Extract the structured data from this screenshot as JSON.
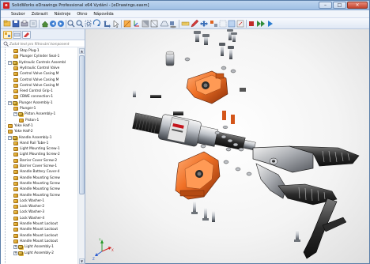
{
  "window": {
    "title": "SolidWorks eDrawings Professional x64 Vydání - [eDrawings.easm]",
    "app_icon": "edrawings-logo-icon",
    "controls": [
      "minimize-icon",
      "maximize-icon",
      "close-icon"
    ]
  },
  "menu": [
    "Soubor",
    "Zobrazit",
    "Nástroje",
    "Okno",
    "Nápověda"
  ],
  "toolbar": {
    "icons": [
      "open-icon",
      "save-icon",
      "print-icon",
      "options-icon",
      "home-icon",
      "previous-icon",
      "next-icon",
      "zoom-fit-icon",
      "zoom-icon",
      "zoom-area-icon",
      "rotate-icon",
      "pan-icon",
      "select-icon",
      "section-icon",
      "3d-pointer-icon",
      "shaded-icon",
      "wireframe-icon",
      "perspective-icon",
      "shadows-icon",
      "measure-icon",
      "mark-up-icon",
      "move-icon",
      "explode-icon",
      "hide-icon",
      "transparency-icon",
      "reset-icon",
      "stop-icon",
      "animate-icon",
      "play-icon"
    ]
  },
  "panel": {
    "tabs": [
      "components-icon",
      "configurations-icon",
      "markup-icon"
    ],
    "search_placeholder": "Zadat text pro filtrování komponent"
  },
  "tree": [
    {
      "label": "Stop Plug-1",
      "type": "part",
      "level": 2
    },
    {
      "label": "Plunger Cylinder Seal-1",
      "type": "part",
      "level": 2
    },
    {
      "label": "Hydraulic Controls Assembl",
      "type": "asm",
      "level": 1,
      "expanded": true
    },
    {
      "label": "Hydraulic Control Valve",
      "type": "part",
      "level": 2
    },
    {
      "label": "Control Valve Casing M",
      "type": "part",
      "level": 2
    },
    {
      "label": "Control Valve Casing M",
      "type": "part",
      "level": 2
    },
    {
      "label": "Control Valve Casing M",
      "type": "part",
      "level": 2
    },
    {
      "label": "Feed Control Grip-1",
      "type": "part",
      "level": 2
    },
    {
      "label": "CBWE connection-1",
      "type": "part",
      "level": 2
    },
    {
      "label": "Plunger Assembly-1",
      "type": "asm",
      "level": 1,
      "expanded": true
    },
    {
      "label": "Plunger-1",
      "type": "part",
      "level": 2
    },
    {
      "label": "Piston Assembly-1",
      "type": "asm",
      "level": 2,
      "expanded": true
    },
    {
      "label": "Piston-1",
      "type": "part",
      "level": 3
    },
    {
      "label": "Yoke Half-1",
      "type": "part",
      "level": 1
    },
    {
      "label": "Yoke Half-2",
      "type": "part",
      "level": 1
    },
    {
      "label": "Handle Assembly-1",
      "type": "asm",
      "level": 1,
      "expanded": true
    },
    {
      "label": "Hand Rail Tube-1",
      "type": "part",
      "level": 2
    },
    {
      "label": "Light Mounting Screw-1",
      "type": "part",
      "level": 2
    },
    {
      "label": "Light Mounting Screw-2",
      "type": "part",
      "level": 2
    },
    {
      "label": "Barrier Cover Screw-2",
      "type": "part",
      "level": 2
    },
    {
      "label": "Barrier Cover Screw-1",
      "type": "part",
      "level": 2
    },
    {
      "label": "Handle Battery Cover-4",
      "type": "part",
      "level": 2
    },
    {
      "label": "Handle Mounting Screw",
      "type": "part",
      "level": 2
    },
    {
      "label": "Handle Mounting Screw",
      "type": "part",
      "level": 2
    },
    {
      "label": "Handle Mounting Screw",
      "type": "part",
      "level": 2
    },
    {
      "label": "Handle Mounting Screw",
      "type": "part",
      "level": 2
    },
    {
      "label": "Lock Washer-1",
      "type": "part",
      "level": 2
    },
    {
      "label": "Lock Washer-2",
      "type": "part",
      "level": 2
    },
    {
      "label": "Lock Washer-3",
      "type": "part",
      "level": 2
    },
    {
      "label": "Lock Washer-4",
      "type": "part",
      "level": 2
    },
    {
      "label": "Handle Mount Lockout",
      "type": "part",
      "level": 2
    },
    {
      "label": "Handle Mount Lockout",
      "type": "part",
      "level": 2
    },
    {
      "label": "Handle Mount Lockout",
      "type": "part",
      "level": 2
    },
    {
      "label": "Handle Mount Lockout",
      "type": "part",
      "level": 2
    },
    {
      "label": "Light Assembly-1",
      "type": "asm",
      "level": 2
    },
    {
      "label": "Light Assembly-2",
      "type": "asm",
      "level": 2
    }
  ],
  "viewport": {
    "triad_axes": [
      "X",
      "Y",
      "Z"
    ],
    "accent_orange": "#e0621e",
    "model_parts": [
      "stop-plug-icon",
      "hydraulic-block-icon",
      "plunger-cylinder-icon",
      "jaw-blade-icon",
      "handle-icon",
      "yoke-half-icon",
      "washer-icon",
      "screw-icon"
    ]
  }
}
